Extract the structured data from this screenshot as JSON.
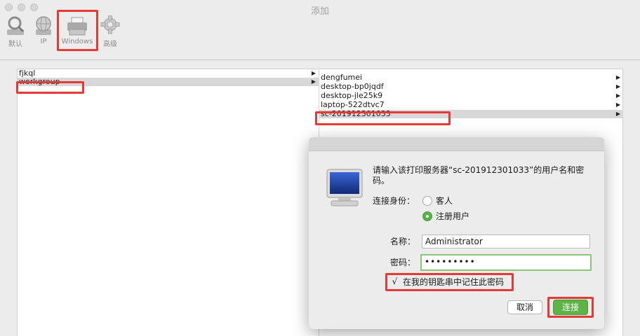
{
  "window": {
    "title": "添加"
  },
  "toolbar": {
    "items": [
      {
        "label": "默认",
        "icon": "search-magnifier-icon"
      },
      {
        "label": "IP",
        "icon": "globe-icon"
      },
      {
        "label": "Windows",
        "icon": "windows-printer-icon"
      },
      {
        "label": "高级",
        "icon": "gear-icon"
      }
    ]
  },
  "browser": {
    "col1": [
      "fjkql",
      "workgroup"
    ],
    "col2": [
      "dengfumei",
      "desktop-bp0jqdf",
      "desktop-jle25k9",
      "laptop-522dtvc7",
      "sc-201912301033"
    ]
  },
  "dialog": {
    "message": "请输入该打印服务器“sc-201912301033”的用户名和密码。",
    "connect_as_label": "连接身份：",
    "guest_label": "客人",
    "registered_label": "注册用户",
    "name_label": "名称：",
    "name_value": "Administrator",
    "password_label": "密码：",
    "password_value": "•••••••••",
    "remember_label": "在我的钥匙串中记住此密码",
    "remember_checked": "√",
    "cancel_label": "取消",
    "connect_label": "连接"
  },
  "colors": {
    "accent_green": "#5cb346",
    "highlight_red": "#e53935",
    "selection_gray": "#d8d8d8"
  }
}
